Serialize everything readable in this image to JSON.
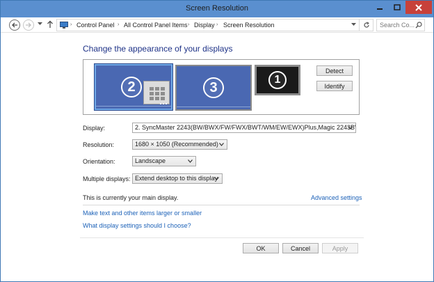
{
  "window": {
    "title": "Screen Resolution"
  },
  "address_bar": {
    "breadcrumbs": [
      "Control Panel",
      "All Control Panel Items",
      "Display",
      "Screen Resolution"
    ],
    "search_placeholder": "Search Co..."
  },
  "main": {
    "heading": "Change the appearance of your displays",
    "monitors": [
      {
        "number": "2",
        "selected": true
      },
      {
        "number": "3",
        "selected": false
      },
      {
        "number": "1",
        "selected": false
      }
    ],
    "buttons": {
      "detect": "Detect",
      "identify": "Identify"
    },
    "fields": {
      "display": {
        "label": "Display:",
        "value": "2. SyncMaster 2243(BW/BWX/FW/FWX/BWT/WM/EW/EWX)Plus,Magic 2243BW(X"
      },
      "resolution": {
        "label": "Resolution:",
        "value": "1680 × 1050 (Recommended)"
      },
      "orientation": {
        "label": "Orientation:",
        "value": "Landscape"
      },
      "multiple_displays": {
        "label": "Multiple displays:",
        "value": "Extend desktop to this display"
      }
    },
    "status_text": "This is currently your main display.",
    "advanced_link": "Advanced settings",
    "links": [
      "Make text and other items larger or smaller",
      "What display settings should I choose?"
    ]
  },
  "footer": {
    "ok": "OK",
    "cancel": "Cancel",
    "apply": "Apply"
  },
  "colors": {
    "titlebar": "#5a8fcf",
    "close": "#c7413a",
    "heading": "#1e3287",
    "link": "#1d62b8",
    "monitor": "#4a68b2"
  }
}
